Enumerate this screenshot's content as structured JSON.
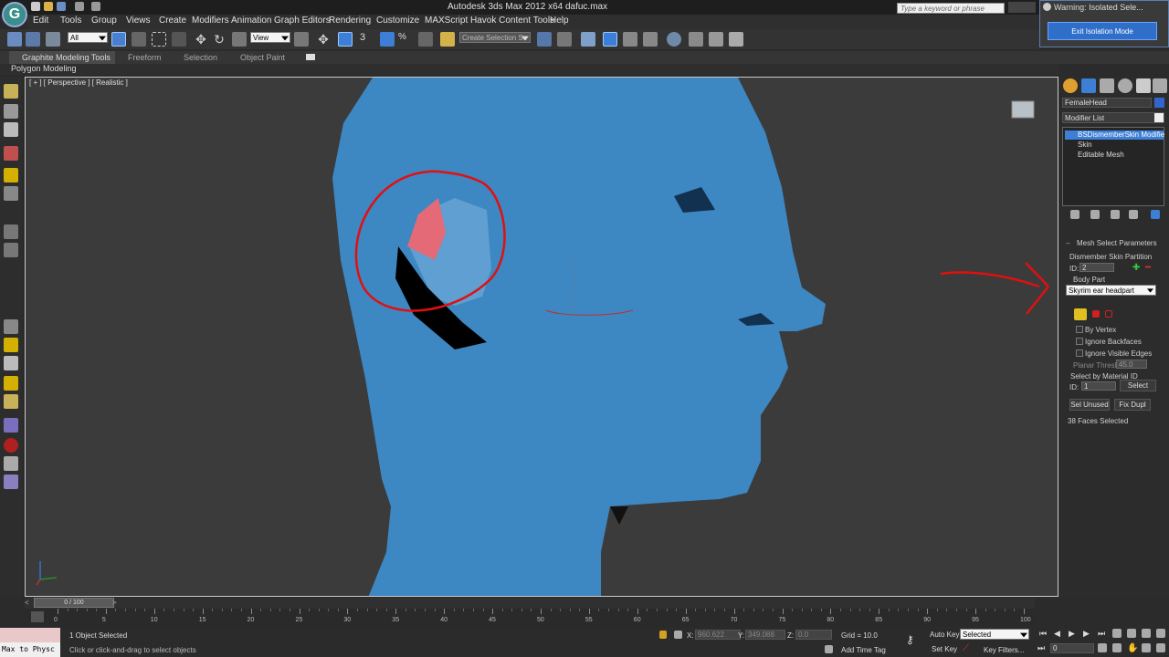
{
  "window": {
    "title": "Autodesk 3ds Max  2012 x64     dafuc.max",
    "search_placeholder": "Type a keyword or phrase"
  },
  "menu": [
    "Edit",
    "Tools",
    "Group",
    "Views",
    "Create",
    "Modifiers",
    "Animation",
    "Graph Editors",
    "Rendering",
    "Customize",
    "MAXScript",
    "Havok Content Tools",
    "Help"
  ],
  "warning": {
    "title": "Warning: Isolated Sele...",
    "button": "Exit Isolation Mode"
  },
  "toolbar": {
    "filter_value": "All",
    "ref_coord": "View",
    "selection_set": "Create Selection Se"
  },
  "ribbon": {
    "tabs": [
      "Graphite Modeling Tools",
      "Freeform",
      "Selection",
      "Object Paint"
    ],
    "sub_label": "Polygon Modeling"
  },
  "viewport": {
    "label": "[ + ] [ Perspective ] [ Realistic ]"
  },
  "command_panel": {
    "object_name": "FemaleHead",
    "modifier_list": "Modifier List",
    "stack": [
      "BSDismemberSkin Modifie",
      "Skin",
      "Editable Mesh"
    ],
    "rollout_title": "Mesh Select Parameters",
    "dismember_label": "Dismember Skin Partition",
    "id_label": "ID:",
    "id_value": "2",
    "body_part_label": "Body Part",
    "body_part_value": "Skyrim ear headpart",
    "by_vertex": "By Vertex",
    "ignore_backfaces": "Ignore Backfaces",
    "ignore_visible_edges": "Ignore Visible Edges",
    "planar_thresh_label": "Planar Thresh:",
    "planar_thresh_value": "45.0",
    "select_by_material": "Select by Material ID",
    "material_id_value": "1",
    "select_button": "Select",
    "sel_unused": "Sel Unused",
    "fix_dupl": "Fix Dupl",
    "status": "38 Faces Selected"
  },
  "timeline": {
    "frame_counter": "0 / 100",
    "ticks": [
      "0",
      "5",
      "10",
      "15",
      "20",
      "25",
      "30",
      "35",
      "40",
      "45",
      "50",
      "55",
      "60",
      "65",
      "70",
      "75",
      "80",
      "85",
      "90",
      "95",
      "100"
    ]
  },
  "status": {
    "maxscript": "Max to Physc",
    "selected": "1 Object Selected",
    "prompt": "Click or click-and-drag to select objects",
    "x_label": "X:",
    "x_value": "960.622",
    "y_label": "Y:",
    "y_value": "349.088",
    "z_label": "Z:",
    "z_value": "0.0",
    "grid": "Grid = 10.0",
    "add_time_tag": "Add Time Tag",
    "auto_key": "Auto Key",
    "auto_key_value": "Selected",
    "set_key": "Set Key",
    "key_filters": "Key Filters...",
    "frame_value": "0"
  }
}
